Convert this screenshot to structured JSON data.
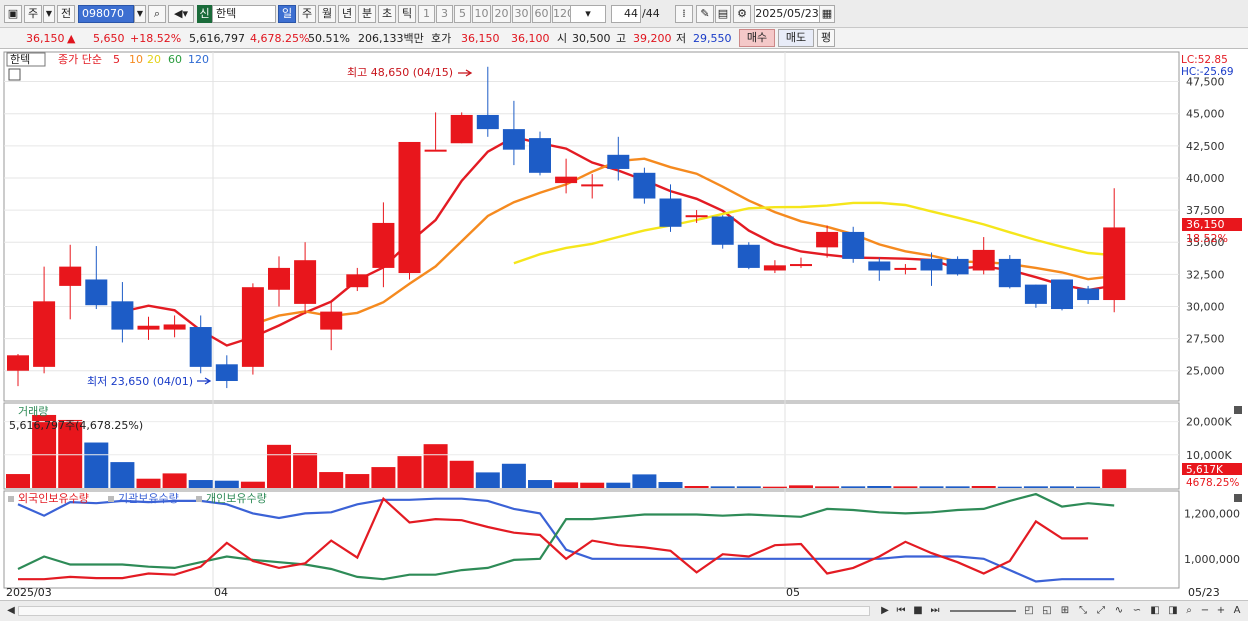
{
  "toolbar": {
    "period_labels": [
      "주",
      "전"
    ],
    "stock_code": "098070",
    "stock_badge": "신",
    "stock_name": "한텍",
    "intervals": [
      "일",
      "주",
      "월",
      "년",
      "분",
      "초",
      "틱"
    ],
    "numbers": [
      "1",
      "3",
      "5",
      "10",
      "20",
      "30",
      "60",
      "120"
    ],
    "count": "44",
    "count_total": "/44",
    "date": "2025/05/23"
  },
  "quote": {
    "price": "36,150",
    "arrow": "▲",
    "change": "5,650",
    "change_pct": "+18.52%",
    "volume": "5,616,797",
    "vol_ratio": "4,678.25%",
    "rate": "50.51%",
    "amount": "206,133백만",
    "hoga_label": "호가",
    "ask": "36,150",
    "bid": "36,100",
    "open_label": "시",
    "open": "30,500",
    "high_label": "고",
    "high": "39,200",
    "low_label": "저",
    "low": "29,550",
    "buy_label": "매수",
    "sell_label": "매도",
    "avg_label": "평"
  },
  "price_panel": {
    "tab_name": "한텍",
    "ma_label": "종가 단순",
    "ma_periods": [
      "5",
      "10",
      "20",
      "60",
      "120"
    ],
    "lc": "LC:52.85",
    "hc": "HC:-25.69",
    "high_annotation": "최고 48,650 (04/15)",
    "low_annotation": "최저 23,650 (04/01)",
    "last_price_tag": "36,150",
    "last_pct_tag": "18.52%",
    "y_ticks": [
      "47,500",
      "45,000",
      "42,500",
      "40,000",
      "37,500",
      "35,000",
      "32,500",
      "30,000",
      "27,500",
      "25,000"
    ]
  },
  "volume_panel": {
    "title": "거래량",
    "readout": "5,616,797주(4,678.25%)",
    "y_ticks": [
      "20,000K",
      "10,000K"
    ],
    "last_vol_tag": "5,617K",
    "last_pct_tag": "4678.25%"
  },
  "holdings_panel": {
    "legend": [
      "외국인보유수량",
      "기관보유수량",
      "개인보유수량"
    ],
    "y_ticks": [
      "1,200,000",
      "1,000,000"
    ]
  },
  "x_axis": {
    "labels": [
      "2025/03",
      "04",
      "05",
      "05/23"
    ]
  },
  "colors": {
    "up": "#e8161c",
    "down": "#1d5cc6",
    "ma5": "#e31b23",
    "ma10": "#f58a1f",
    "ma20": "#f5e61b",
    "ma60": "#2a9c3e",
    "ma120": "#2f6bd3",
    "foreign": "#e31b23",
    "institution": "#3b62d6",
    "individual": "#2e8b57"
  },
  "chart_data": {
    "type": "candlestick",
    "series": [
      {
        "name": "candles",
        "ohlc": [
          [
            25000,
            26200,
            23800,
            26300
          ],
          [
            25300,
            30400,
            24800,
            33100
          ],
          [
            31600,
            33100,
            29000,
            34800
          ],
          [
            32100,
            30100,
            29800,
            34700
          ],
          [
            30400,
            28200,
            27200,
            31900
          ],
          [
            28200,
            28500,
            27400,
            29200
          ],
          [
            28200,
            28600,
            27600,
            29300
          ],
          [
            28400,
            25300,
            24800,
            29300
          ],
          [
            25500,
            24200,
            23650,
            26200
          ],
          [
            25300,
            31500,
            24700,
            31800
          ],
          [
            31300,
            33000,
            30000,
            33900
          ],
          [
            30200,
            33600,
            29400,
            35000
          ],
          [
            28200,
            29600,
            26600,
            30400
          ],
          [
            31500,
            32500,
            31200,
            33000
          ],
          [
            33000,
            36500,
            31500,
            38100
          ],
          [
            32600,
            42800,
            32100,
            42800
          ],
          [
            42200,
            42200,
            42200,
            45100
          ],
          [
            42700,
            44900,
            42700,
            45100
          ],
          [
            44900,
            43800,
            43200,
            48650
          ],
          [
            43800,
            42200,
            41000,
            46000
          ],
          [
            43100,
            40400,
            40200,
            43600
          ],
          [
            39600,
            40100,
            38800,
            41500
          ],
          [
            39500,
            39500,
            38400,
            40300
          ],
          [
            41800,
            40700,
            39800,
            43200
          ],
          [
            40400,
            38400,
            38000,
            40800
          ],
          [
            38400,
            36200,
            35800,
            39500
          ],
          [
            37100,
            37100,
            36500,
            37500
          ],
          [
            37000,
            34800,
            34500,
            37100
          ],
          [
            34800,
            33000,
            32900,
            35000
          ],
          [
            32800,
            33200,
            32600,
            33600
          ],
          [
            33300,
            33300,
            33000,
            33800
          ],
          [
            34600,
            35800,
            33800,
            36300
          ],
          [
            35800,
            33700,
            33400,
            36200
          ],
          [
            33500,
            32800,
            32000,
            33800
          ],
          [
            32900,
            33000,
            32500,
            33300
          ],
          [
            33700,
            32800,
            31600,
            34200
          ],
          [
            33700,
            32500,
            32400,
            33900
          ],
          [
            32800,
            34400,
            32500,
            35400
          ],
          [
            33700,
            31500,
            31400,
            34000
          ],
          [
            31700,
            30200,
            29900,
            31700
          ],
          [
            32100,
            29800,
            29700,
            32100
          ],
          [
            31400,
            30500,
            30200,
            31600
          ],
          [
            30500,
            36150,
            29550,
            39200
          ]
        ]
      },
      {
        "name": "volume_k",
        "values": [
          4200,
          22000,
          20500,
          13700,
          7800,
          2800,
          4400,
          2400,
          2200,
          1900,
          13000,
          10500,
          4800,
          4200,
          6300,
          9600,
          13200,
          8200,
          4700,
          7300,
          2400,
          1700,
          1600,
          1600,
          4100,
          1800,
          600,
          500,
          500,
          400,
          800,
          500,
          500,
          600,
          500,
          500,
          500,
          600,
          400,
          500,
          500,
          400,
          5617
        ]
      },
      {
        "name": "외국인보유수량",
        "values": [
          910000,
          910000,
          920000,
          915000,
          915000,
          935000,
          930000,
          965000,
          1070000,
          990000,
          960000,
          980000,
          1080000,
          1005000,
          1265000,
          1160000,
          1175000,
          1170000,
          1140000,
          1115000,
          1105000,
          1000000,
          1080000,
          1060000,
          1050000,
          1035000,
          940000,
          1020000,
          1010000,
          1060000,
          1065000,
          935000,
          960000,
          1010000,
          1075000,
          1025000,
          985000,
          935000,
          990000,
          1165000,
          1090000,
          1090000
        ]
      },
      {
        "name": "기관보유수량",
        "values": [
          1240000,
          1190000,
          1250000,
          1245000,
          1255000,
          1250000,
          1255000,
          1255000,
          1240000,
          1200000,
          1180000,
          1200000,
          1205000,
          1240000,
          1260000,
          1260000,
          1265000,
          1265000,
          1255000,
          1220000,
          1200000,
          1040000,
          1000000,
          1000000,
          1000000,
          1000000,
          1000000,
          1000000,
          1000000,
          1000000,
          1000000,
          1000000,
          1000000,
          1000000,
          1010000,
          1010000,
          1010000,
          1000000,
          950000,
          900000,
          910000,
          910000,
          910000
        ]
      },
      {
        "name": "개인보유수량",
        "values": [
          955000,
          1010000,
          975000,
          975000,
          975000,
          965000,
          960000,
          985000,
          1010000,
          995000,
          985000,
          975000,
          955000,
          920000,
          910000,
          930000,
          930000,
          950000,
          960000,
          995000,
          1000000,
          1175000,
          1175000,
          1185000,
          1195000,
          1195000,
          1195000,
          1190000,
          1195000,
          1190000,
          1185000,
          1220000,
          1215000,
          1205000,
          1200000,
          1205000,
          1215000,
          1220000,
          1255000,
          1285000,
          1230000,
          1245000,
          1235000
        ]
      }
    ],
    "y_range": [
      22800,
      49800
    ],
    "volume_range": [
      0,
      25000
    ],
    "holdings_range": [
      880000,
      1290000
    ],
    "dates_axis": [
      "2025/03",
      "04",
      "05",
      "05/23"
    ]
  }
}
